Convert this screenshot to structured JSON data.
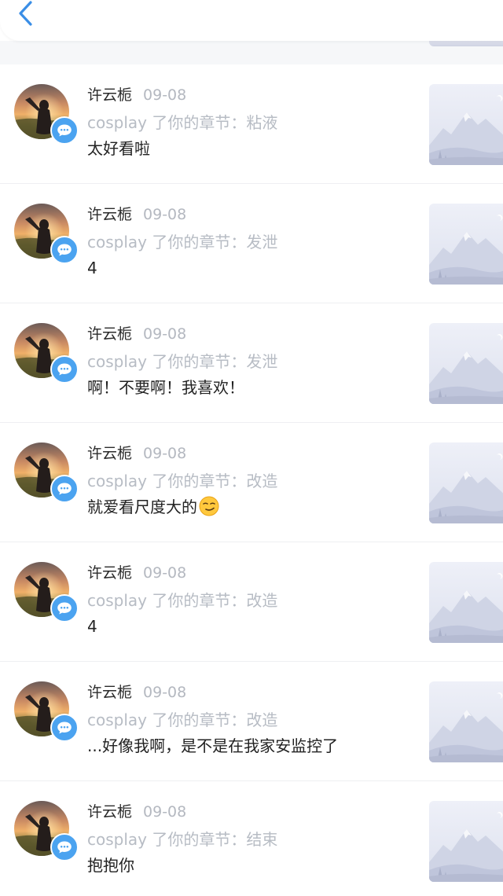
{
  "header": {
    "back_icon": "chevron-left-icon",
    "accent_color": "#3a8ee6"
  },
  "items": [
    {
      "name": "许云栀",
      "date": "09-08",
      "chapter_label": "cosplay 了你的章节：粘液",
      "comment": "太好看啦"
    },
    {
      "name": "许云栀",
      "date": "09-08",
      "chapter_label": "cosplay 了你的章节：发泄",
      "comment": "4"
    },
    {
      "name": "许云栀",
      "date": "09-08",
      "chapter_label": "cosplay 了你的章节：发泄",
      "comment": "啊！不要啊！我喜欢！"
    },
    {
      "name": "许云栀",
      "date": "09-08",
      "chapter_label": "cosplay 了你的章节：改造",
      "comment": "就爱看尺度大的",
      "emoji": "smirking-face-emoji"
    },
    {
      "name": "许云栀",
      "date": "09-08",
      "chapter_label": "cosplay 了你的章节：改造",
      "comment": "4"
    },
    {
      "name": "许云栀",
      "date": "09-08",
      "chapter_label": "cosplay 了你的章节：改造",
      "comment": "...好像我啊，是不是在我家安监控了"
    },
    {
      "name": "许云栀",
      "date": "09-08",
      "chapter_label": "cosplay 了你的章节：结束",
      "comment": "抱抱你"
    }
  ]
}
